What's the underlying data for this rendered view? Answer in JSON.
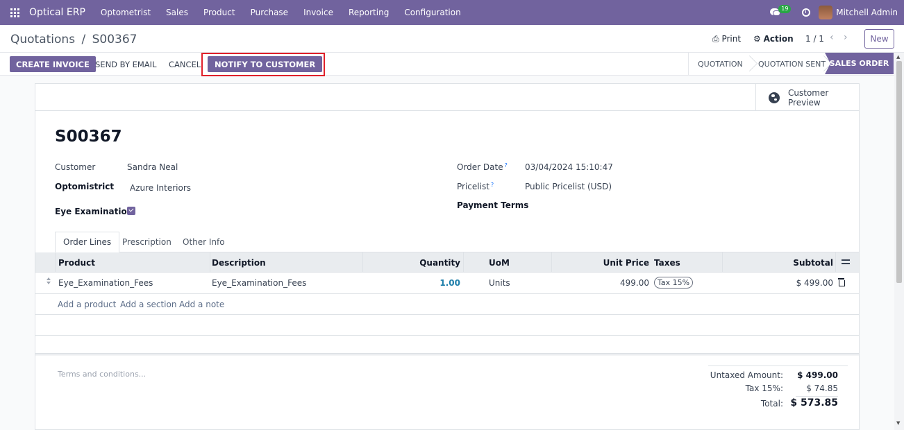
{
  "navbar": {
    "brand": "Optical ERP",
    "menu": [
      "Optometrist",
      "Sales",
      "Product",
      "Purchase",
      "Invoice",
      "Reporting",
      "Configuration"
    ],
    "chat_count": "19",
    "user": "Mitchell Admin"
  },
  "control": {
    "breadcrumb_parent": "Quotations",
    "breadcrumb_sep": "/",
    "breadcrumb_current": "S00367",
    "print": "Print",
    "action": "Action",
    "pager": "1 / 1",
    "new": "New"
  },
  "statusbar": {
    "create_invoice": "CREATE INVOICE",
    "send_by_email": "SEND BY EMAIL",
    "cancel": "CANCEL",
    "notify": "NOTIFY TO CUSTOMER",
    "stages": [
      "QUOTATION",
      "QUOTATION SENT",
      "SALES ORDER"
    ],
    "active_stage": "SALES ORDER"
  },
  "sheet": {
    "preview_label": "Customer Preview",
    "title": "S00367",
    "fields": {
      "customer_label": "Customer",
      "customer_value": "Sandra Neal",
      "optometrist_label": "Optomistrict",
      "optometrist_value": "Azure Interiors",
      "eye_exam_label": "Eye Examination",
      "eye_exam_checked": true,
      "order_date_label": "Order Date",
      "order_date_value": "03/04/2024 15:10:47",
      "pricelist_label": "Pricelist",
      "pricelist_value": "Public Pricelist (USD)",
      "payment_terms_label": "Payment Terms",
      "help_mark": "?"
    },
    "tabs": [
      "Order Lines",
      "Prescription",
      "Other Info"
    ],
    "table": {
      "headers": {
        "product": "Product",
        "description": "Description",
        "quantity": "Quantity",
        "uom": "UoM",
        "unit_price": "Unit Price",
        "taxes": "Taxes",
        "subtotal": "Subtotal"
      },
      "rows": [
        {
          "product": "Eye_Examination_Fees",
          "description": "Eye_Examination_Fees",
          "quantity": "1.00",
          "uom": "Units",
          "unit_price": "499.00",
          "taxes": "Tax 15%",
          "subtotal": "$ 499.00"
        }
      ],
      "add_product": "Add a product",
      "add_section": "Add a section",
      "add_note": "Add a note"
    },
    "terms_placeholder": "Terms and conditions...",
    "totals": {
      "untaxed_label": "Untaxed Amount:",
      "untaxed_value": "$ 499.00",
      "tax_label": "Tax 15%:",
      "tax_value": "$ 74.85",
      "total_label": "Total:",
      "total_value": "$ 573.85"
    }
  },
  "colors": {
    "brand": "#71639e",
    "highlight": "#e0202a",
    "badge": "#28a745"
  }
}
